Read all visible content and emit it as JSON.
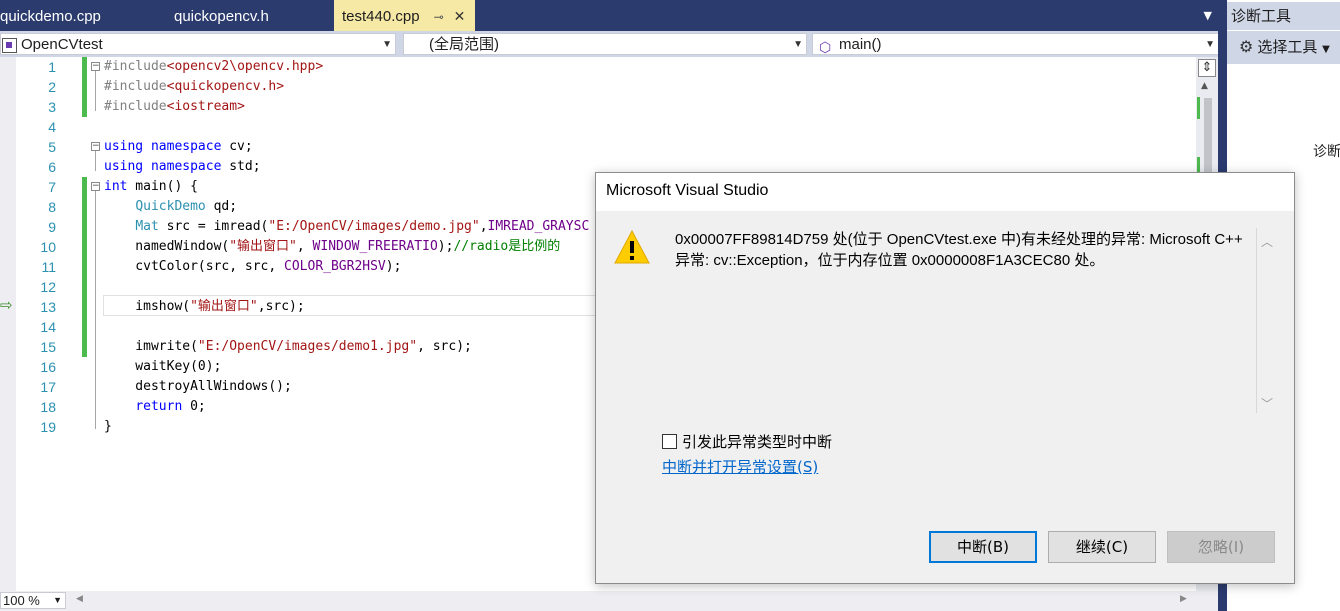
{
  "tabs": [
    {
      "label": "quickdemo.cpp",
      "active": false
    },
    {
      "label": "quickopencv.h",
      "active": false
    },
    {
      "label": "test440.cpp",
      "active": true
    }
  ],
  "navbar": {
    "project": "OpenCVtest",
    "scope": "(全局范围)",
    "member": "main()"
  },
  "editor": {
    "line_numbers": [
      "1",
      "2",
      "3",
      "4",
      "5",
      "6",
      "7",
      "8",
      "9",
      "10",
      "11",
      "12",
      "13",
      "14",
      "15",
      "16",
      "17",
      "18",
      "19"
    ],
    "current_line": 13,
    "zoom": "100 %"
  },
  "dialog": {
    "title": "Microsoft Visual Studio",
    "message": "0x00007FF89814D759 处(位于 OpenCVtest.exe 中)有未经处理的异常: Microsoft C++ 异常: cv::Exception，位于内存位置 0x0000008F1A3CEC80 处。",
    "checkbox_label": "引发此异常类型时中断",
    "checkbox_checked": false,
    "link": "中断并打开异常设置(S)",
    "buttons": {
      "break": "中断(B)",
      "continue": "继续(C)",
      "ignore": "忽略(I)"
    }
  },
  "diagnostics": {
    "title": "诊断工具",
    "select_tool": "选择工具",
    "partial_text": "诊断"
  },
  "colors": {
    "accent": "#2b3b6e",
    "active_tab": "#f5e9a5",
    "change_marker": "#4cba4c",
    "link": "#0066cc",
    "focused_button_border": "#0078d7"
  }
}
